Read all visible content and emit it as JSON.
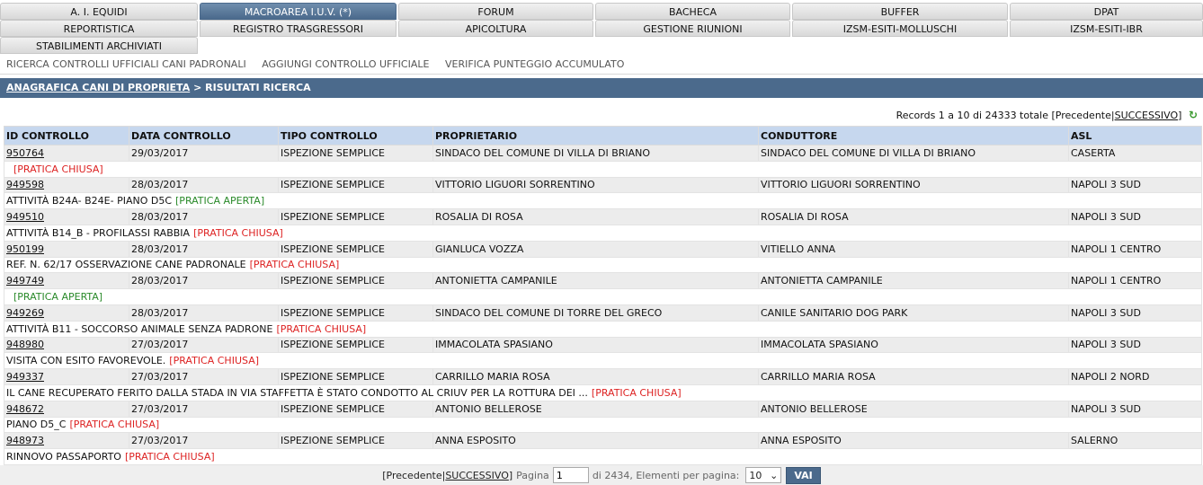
{
  "tabs": [
    {
      "label": "A. I. EQUIDI"
    },
    {
      "label": "MACROAREA I.U.V. (*)"
    },
    {
      "label": "FORUM"
    },
    {
      "label": "BACHECA"
    },
    {
      "label": "BUFFER"
    },
    {
      "label": "DPAT"
    },
    {
      "label": "REPORTISTICA"
    },
    {
      "label": "REGISTRO TRASGRESSORI"
    },
    {
      "label": "APICOLTURA"
    },
    {
      "label": "GESTIONE RIUNIONI"
    },
    {
      "label": "IZSM-ESITI-MOLLUSCHI"
    },
    {
      "label": "IZSM-ESITI-IBR"
    },
    {
      "label": "STABILIMENTI ARCHIVIATI"
    }
  ],
  "subnav": [
    "RICERCA CONTROLLI UFFICIALI CANI PADRONALI",
    "AGGIUNGI CONTROLLO UFFICIALE",
    "VERIFICA PUNTEGGIO ACCUMULATO"
  ],
  "breadcrumb": {
    "link": "ANAGRAFICA CANI DI PROPRIETA",
    "sep": " > ",
    "current": "RISULTATI RICERCA"
  },
  "records": {
    "text": "Records 1 a 10 di 24333 totale [Precedente|",
    "next": "SUCCESSIVO",
    "end": "]"
  },
  "columns": [
    "ID CONTROLLO",
    "DATA CONTROLLO",
    "TIPO CONTROLLO",
    "PROPRIETARIO",
    "CONDUTTORE",
    "ASL"
  ],
  "rows": [
    {
      "id": "950764",
      "data": "29/03/2017",
      "tipo": "ISPEZIONE SEMPLICE",
      "proprietario": "SINDACO DEL COMUNE DI VILLA DI BRIANO",
      "conduttore": "SINDACO DEL COMUNE DI VILLA DI BRIANO",
      "asl": "CASERTA",
      "note": "",
      "stato": "[PRATICA CHIUSA]",
      "status_color": "#dd2222"
    },
    {
      "id": "949598",
      "data": "28/03/2017",
      "tipo": "ISPEZIONE SEMPLICE",
      "proprietario": "VITTORIO LIGUORI SORRENTINO",
      "conduttore": "VITTORIO LIGUORI SORRENTINO",
      "asl": "NAPOLI 3 SUD",
      "note": "ATTIVITÀ B24A- B24E- PIANO D5C",
      "stato": "[PRATICA APERTA]",
      "status_color": "#2a8a2a"
    },
    {
      "id": "949510",
      "data": "28/03/2017",
      "tipo": "ISPEZIONE SEMPLICE",
      "proprietario": "ROSALIA DI ROSA",
      "conduttore": "ROSALIA DI ROSA",
      "asl": "NAPOLI 3 SUD",
      "note": "ATTIVITÀ B14_B - PROFILASSI RABBIA",
      "stato": "[PRATICA CHIUSA]",
      "status_color": "#dd2222"
    },
    {
      "id": "950199",
      "data": "28/03/2017",
      "tipo": "ISPEZIONE SEMPLICE",
      "proprietario": "GIANLUCA VOZZA",
      "conduttore": "VITIELLO ANNA",
      "asl": "NAPOLI 1 CENTRO",
      "note": "REF. N. 62/17 OSSERVAZIONE CANE PADRONALE",
      "stato": "[PRATICA CHIUSA]",
      "status_color": "#dd2222"
    },
    {
      "id": "949749",
      "data": "28/03/2017",
      "tipo": "ISPEZIONE SEMPLICE",
      "proprietario": "ANTONIETTA CAMPANILE",
      "conduttore": "ANTONIETTA CAMPANILE",
      "asl": "NAPOLI 1 CENTRO",
      "note": "",
      "stato": "[PRATICA APERTA]",
      "status_color": "#2a8a2a"
    },
    {
      "id": "949269",
      "data": "28/03/2017",
      "tipo": "ISPEZIONE SEMPLICE",
      "proprietario": "SINDACO DEL COMUNE DI TORRE DEL GRECO",
      "conduttore": "CANILE SANITARIO DOG PARK",
      "asl": "NAPOLI 3 SUD",
      "note": "ATTIVITÀ B11 - SOCCORSO ANIMALE SENZA PADRONE",
      "stato": "[PRATICA CHIUSA]",
      "status_color": "#dd2222"
    },
    {
      "id": "948980",
      "data": "27/03/2017",
      "tipo": "ISPEZIONE SEMPLICE",
      "proprietario": "IMMACOLATA SPASIANO",
      "conduttore": "IMMACOLATA SPASIANO",
      "asl": "NAPOLI 3 SUD",
      "note": "VISITA CON ESITO FAVOREVOLE.",
      "stato": "[PRATICA CHIUSA]",
      "status_color": "#dd2222"
    },
    {
      "id": "949337",
      "data": "27/03/2017",
      "tipo": "ISPEZIONE SEMPLICE",
      "proprietario": "CARRILLO MARIA ROSA",
      "conduttore": "CARRILLO MARIA ROSA",
      "asl": "NAPOLI 2 NORD",
      "note": "IL CANE RECUPERATO FERITO DALLA STADA IN VIA STAFFETTA È STATO CONDOTTO AL CRIUV PER LA ROTTURA DEI ...",
      "stato": "[PRATICA CHIUSA]",
      "status_color": "#dd2222"
    },
    {
      "id": "948672",
      "data": "27/03/2017",
      "tipo": "ISPEZIONE SEMPLICE",
      "proprietario": "ANTONIO BELLEROSE",
      "conduttore": "ANTONIO BELLEROSE",
      "asl": "NAPOLI 3 SUD",
      "note": "PIANO D5_C",
      "stato": "[PRATICA CHIUSA]",
      "status_color": "#dd2222"
    },
    {
      "id": "948973",
      "data": "27/03/2017",
      "tipo": "ISPEZIONE SEMPLICE",
      "proprietario": "ANNA ESPOSITO",
      "conduttore": "ANNA ESPOSITO",
      "asl": "SALERNO",
      "note": "RINNOVO PASSAPORTO",
      "stato": "[PRATICA CHIUSA]",
      "status_color": "#dd2222"
    }
  ],
  "pager": {
    "prev": "[Precedente|",
    "next": "SUCCESSIVO",
    "end": "]",
    "page_label": "Pagina",
    "page_value": "1",
    "total": "di 2434, Elementi per pagina:",
    "per_page": "10",
    "go": "VAI"
  },
  "colors": {
    "accent": "#4b6a8c",
    "header_bg": "#c6d7ee",
    "chiusa": "#dd2222",
    "aperta": "#2a8a2a"
  }
}
